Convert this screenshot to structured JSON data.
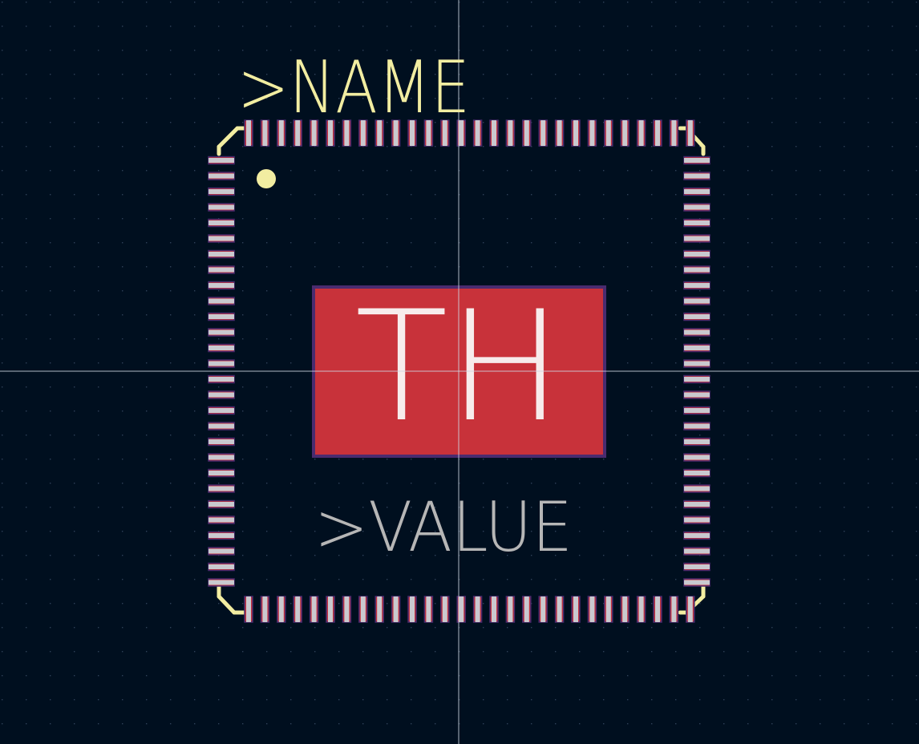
{
  "footprint": {
    "name_field": ">NAME",
    "value_field": ">VALUE",
    "center_text": "TH",
    "pin_count_per_side": 28
  },
  "colors": {
    "background": "#000f1f",
    "grid_dot": "#2f4158",
    "crosshair": "#cfd6e3",
    "silkscreen": "#f2eda1",
    "fab_text": "#b6b6b6",
    "pad_red": "#c8323a",
    "pad_outline": "#4a2b6f",
    "pin_grey": "#c9c9cf",
    "center_pad_text": "#f7ecec"
  }
}
